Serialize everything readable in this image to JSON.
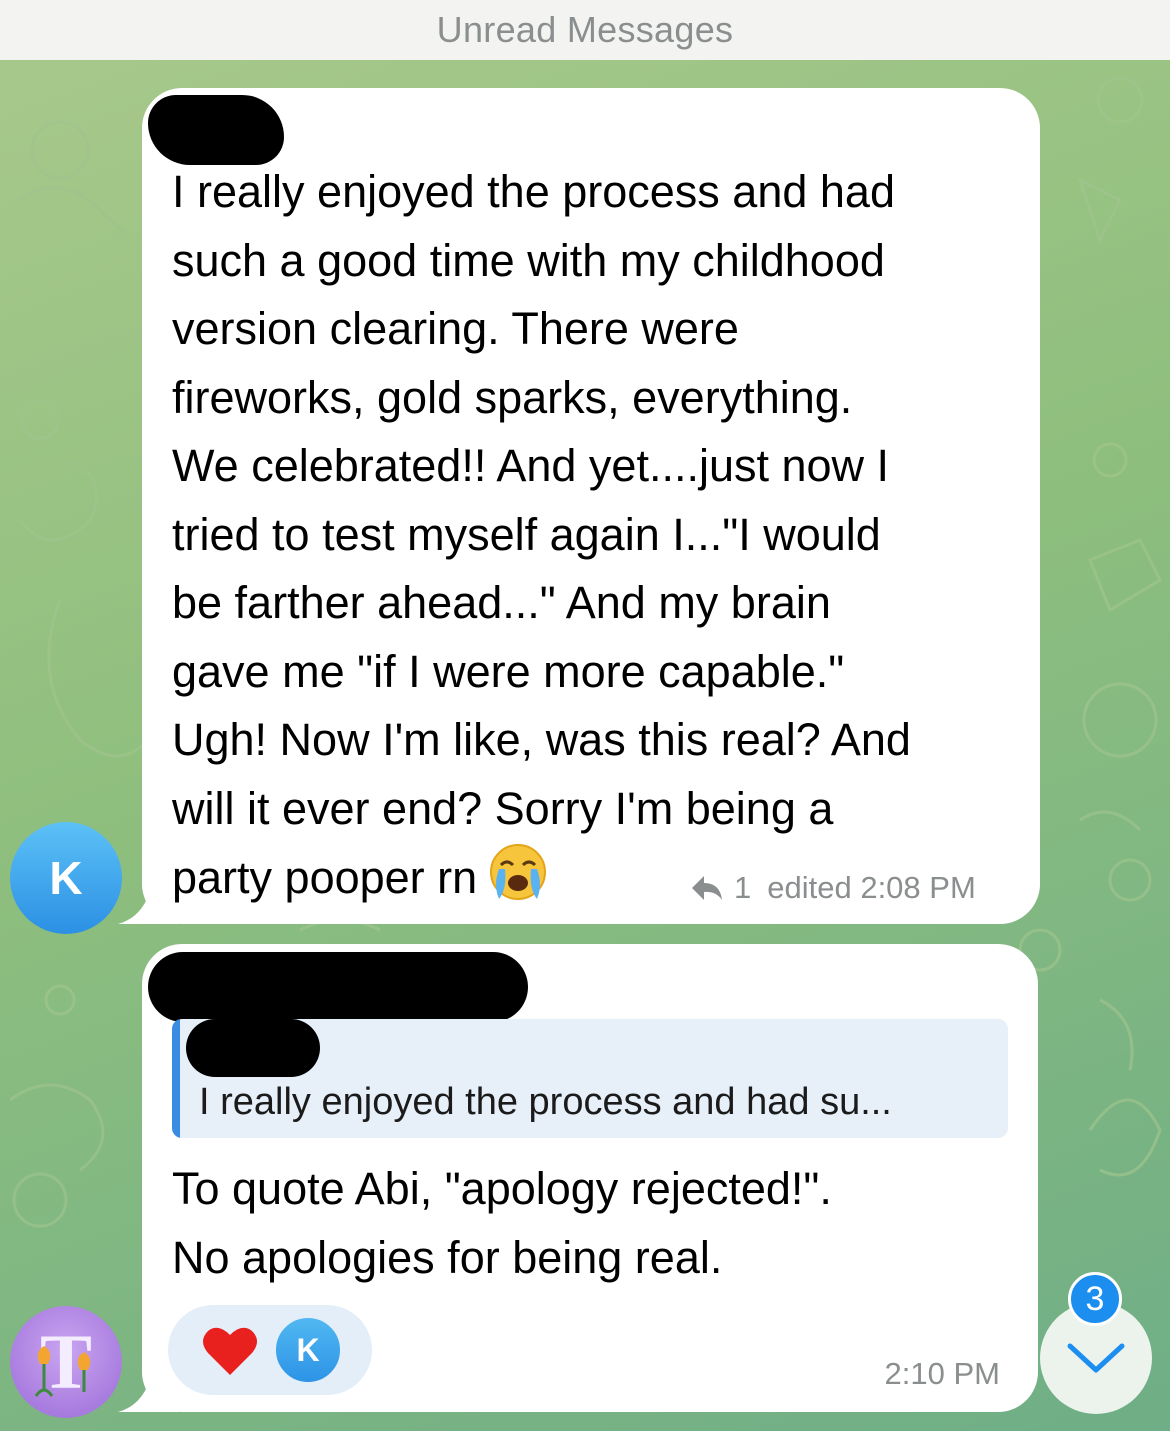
{
  "header": {
    "unread_label": "Unread Messages"
  },
  "messages": [
    {
      "sender_avatar_initial": "K",
      "text": "I really enjoyed the process and had\nsuch a good time with my childhood\nversion clearing. There were\nfireworks, gold sparks, everything.\nWe celebrated!! And yet....just now I\ntried to test myself again I...\"I would\nbe farther ahead...\" And my brain\ngave me \"if I were more capable.\"\nUgh! Now I'm like, was this real? And\nwill it ever end? Sorry I'm being a\nparty pooper rn",
      "emoji": "loudly-crying-face",
      "reply_count": "1",
      "status": "edited 2:08 PM"
    },
    {
      "sender_avatar_initial": "T",
      "quote_text": "I really enjoyed the process and had su...",
      "text": "To quote Abi, \"apology rejected!\".\nNo apologies for being real.",
      "reactions": [
        {
          "icon": "red-heart",
          "reactor_initial": "K"
        }
      ],
      "time": "2:10 PM"
    }
  ],
  "scroll_button": {
    "unread_count": "3",
    "icon": "chevron-down-icon"
  },
  "colors": {
    "accent": "#3a8be2",
    "badge": "#1c8ef0",
    "bubble": "#ffffff",
    "meta_text": "#8a8e8f"
  }
}
